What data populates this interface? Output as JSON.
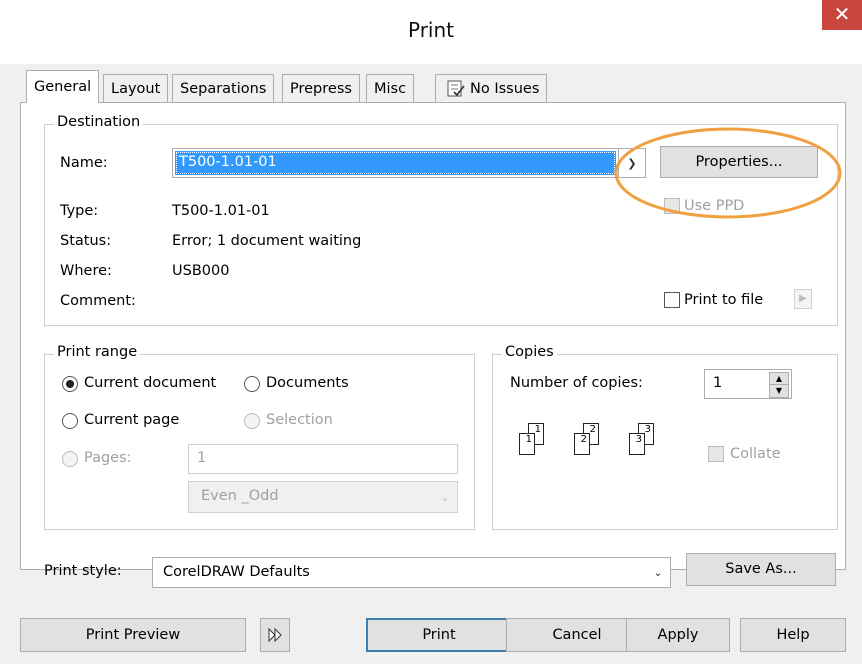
{
  "window": {
    "title": "Print",
    "close_glyph": "✕"
  },
  "tabs": [
    {
      "label": "General",
      "active": true
    },
    {
      "label": "Layout"
    },
    {
      "label": "Separations"
    },
    {
      "label": "Prepress"
    },
    {
      "label": "Misc"
    },
    {
      "label": "No Issues"
    }
  ],
  "destination": {
    "group_label": "Destination",
    "name_label": "Name:",
    "name_value": "T500-1.01-01",
    "properties_button": "Properties...",
    "use_ppd_label": "Use PPD",
    "type_label": "Type:",
    "type_value": "T500-1.01-01",
    "status_label": "Status:",
    "status_value": "Error; 1 document waiting",
    "where_label": "Where:",
    "where_value": "USB000",
    "comment_label": "Comment:",
    "print_to_file_label": "Print to file"
  },
  "print_range": {
    "group_label": "Print range",
    "current_document": "Current document",
    "documents": "Documents",
    "current_page": "Current page",
    "selection": "Selection",
    "pages_label": "Pages:",
    "pages_value": "1",
    "even_odd": "Even _Odd"
  },
  "copies": {
    "group_label": "Copies",
    "number_label": "Number of copies:",
    "number_value": "1",
    "collate_label": "Collate",
    "icon_digits": [
      "1",
      "1",
      "2",
      "2",
      "3",
      "3"
    ]
  },
  "print_style": {
    "label": "Print style:",
    "value": "CorelDRAW Defaults",
    "save_as_button": "Save As..."
  },
  "footer": {
    "print_preview": "Print Preview",
    "print": "Print",
    "cancel": "Cancel",
    "apply": "Apply",
    "help": "Help"
  },
  "colors": {
    "highlight": "#3399ff",
    "annotation_circle": "#f0a040",
    "close_button": "#c8463d"
  }
}
